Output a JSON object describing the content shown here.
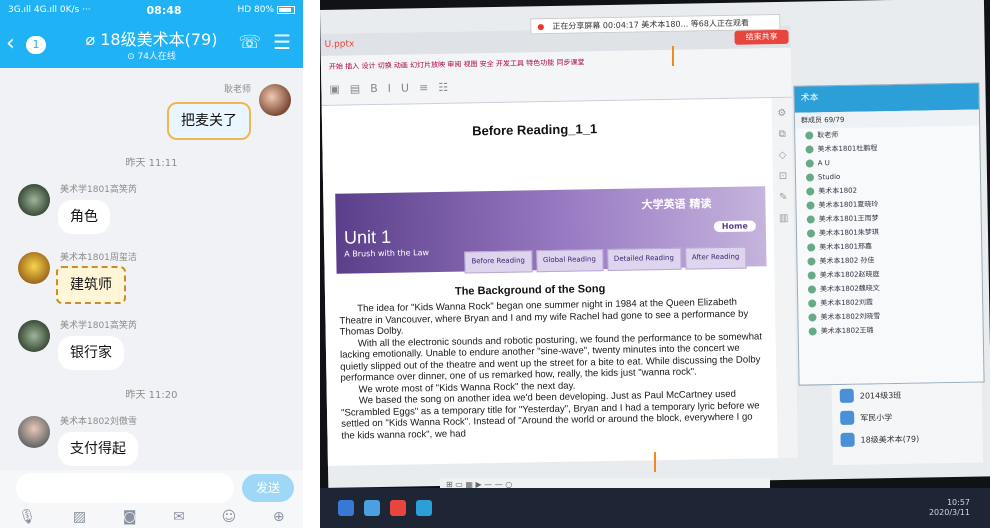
{
  "phone": {
    "status": {
      "left": "3G.ıll 4G.ıll 0K/s ···",
      "time": "08:48",
      "right": "HD 80%"
    },
    "nav": {
      "back_count": "1",
      "title": "18级美术本(79)",
      "online": "74人在线"
    },
    "messages": [
      {
        "sender": "耿老师",
        "text": "把麦关了",
        "side": "right"
      },
      {
        "timestamp": "昨天 11:11"
      },
      {
        "sender": "美术学1801高笑芮",
        "text": "角色",
        "side": "left"
      },
      {
        "sender": "美术本1801周玺洁",
        "text": "建筑师",
        "side": "left"
      },
      {
        "sender": "美术学1801高笑芮",
        "text": "银行家",
        "side": "left"
      },
      {
        "timestamp": "昨天 11:20"
      },
      {
        "sender": "美术本1802刘傲雪",
        "text": "支付得起",
        "side": "left"
      }
    ],
    "input": {
      "send_label": "发送"
    },
    "toolbar_icons": [
      "mic-icon",
      "image-icon",
      "camera-icon",
      "red-packet-icon",
      "emoji-icon",
      "plus-icon"
    ]
  },
  "screen": {
    "shared_bar": "正在分享屏幕  00:04:17  美术本180... 等68人正在观看",
    "share_btn": "结束共享",
    "tab_label": "U.pptx",
    "ribbon_menu": "开始 插入 设计 切换 动画 幻灯片放映 审阅 视图 安全 开发工具 特色功能 同步课堂",
    "doc_title": "Before Reading_1_1",
    "banner": {
      "brand": "大学英语 精读",
      "unit": "Unit 1",
      "subtitle": "A Brush with the Law",
      "home": "Home"
    },
    "tabs": [
      "Before Reading",
      "Global Reading",
      "Detailed Reading",
      "After Reading"
    ],
    "song_title": "The Background of the Song",
    "paragraphs": [
      "The idea for \"Kids Wanna Rock\" began one summer night in 1984 at the Queen Elizabeth Theatre in Vancouver, where Bryan and I and my wife Rachel had gone to see a performance by Thomas Dolby.",
      "With all the electronic sounds and robotic posturing, we found the performance to be somewhat lacking emotionally. Unable to endure another \"sine-wave\", twenty minutes into the concert we quietly slipped out of the theatre and went up the street for a bite to eat. While discussing the Dolby performance over dinner, one of us remarked how, really, the kids just \"wanna rock\".",
      "We wrote most of \"Kids Wanna Rock\" the next day.",
      "We based the song on another idea we'd been developing. Just as Paul McCartney used \"Scrambled Eggs\" as a temporary title for \"Yesterday\", Bryan and I had a temporary lyric before we settled on \"Kids Wanna Rock\". Instead of \"Around the world or around the block, everywhere I go the kids wanna rock\", we had"
    ],
    "qq_panel": {
      "title": "术本",
      "sub": "群成员 69/79",
      "members": [
        "耿老师",
        "美术本1801杜鹏程",
        "A U",
        "Studio",
        "美术本1802",
        "美术本1801夏晓玲",
        "美术本1801王雨梦",
        "美术本1801朱梦琪",
        "美术本1801邢嘉",
        "美术本1802 孙佳",
        "美术本1802赵晓庭",
        "美术本1802魏晓文",
        "美术本1802刘霞",
        "美术本1802刘晓雪",
        "美术本1802王璐"
      ]
    },
    "right_list": [
      "2014级3班",
      "军民小学",
      "18级美术本(79)"
    ],
    "tray": {
      "time": "10:57",
      "date": "2020/3/11"
    }
  }
}
